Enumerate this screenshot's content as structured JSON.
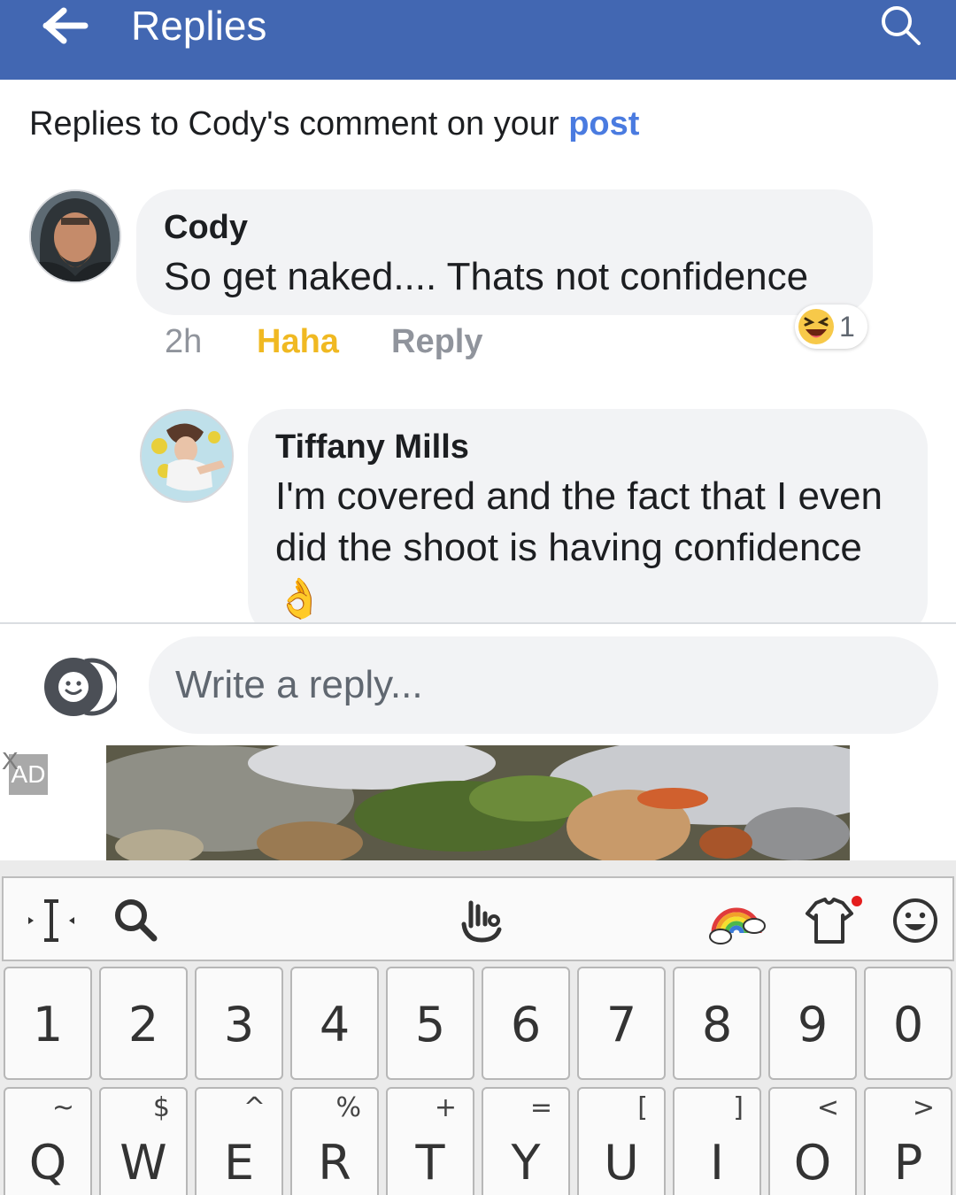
{
  "header": {
    "title": "Replies",
    "back_icon": "back-arrow-icon",
    "search_icon": "search-icon",
    "background": "#4267b2"
  },
  "context": {
    "prefix": "Replies to Cody's comment on your ",
    "link": "post"
  },
  "comments": [
    {
      "author": "Cody",
      "text": "So get naked....  Thats not confidence",
      "time": "2h",
      "reaction_label": "Haha",
      "reply_label": "Reply",
      "reaction_count": "1",
      "reaction_icon": "haha-emoji-icon"
    },
    {
      "author": "Tiffany Mills",
      "text": "I'm covered and the fact that I even did the shoot is having confidence 👌"
    }
  ],
  "composer": {
    "placeholder": "Write a reply...",
    "sticker_icon": "sticker-icon"
  },
  "ad": {
    "badge": "AD",
    "close": "X"
  },
  "keyboard": {
    "toolbar_icons": [
      "text-cursor-icon",
      "search-icon",
      "gesture-icon",
      "rainbow-theme-icon",
      "shirt-icon",
      "smiley-icon"
    ],
    "number_row": [
      "1",
      "2",
      "3",
      "4",
      "5",
      "6",
      "7",
      "8",
      "9",
      "0"
    ],
    "letter_row": [
      {
        "key": "Q",
        "alt": "~"
      },
      {
        "key": "W",
        "alt": "$"
      },
      {
        "key": "E",
        "alt": "^"
      },
      {
        "key": "R",
        "alt": "%"
      },
      {
        "key": "T",
        "alt": "+"
      },
      {
        "key": "Y",
        "alt": "="
      },
      {
        "key": "U",
        "alt": "["
      },
      {
        "key": "I",
        "alt": "]"
      },
      {
        "key": "O",
        "alt": "<"
      },
      {
        "key": "P",
        "alt": ">"
      }
    ]
  },
  "colors": {
    "link": "#4a7be0",
    "haha": "#f0b922",
    "muted": "#90949c"
  }
}
